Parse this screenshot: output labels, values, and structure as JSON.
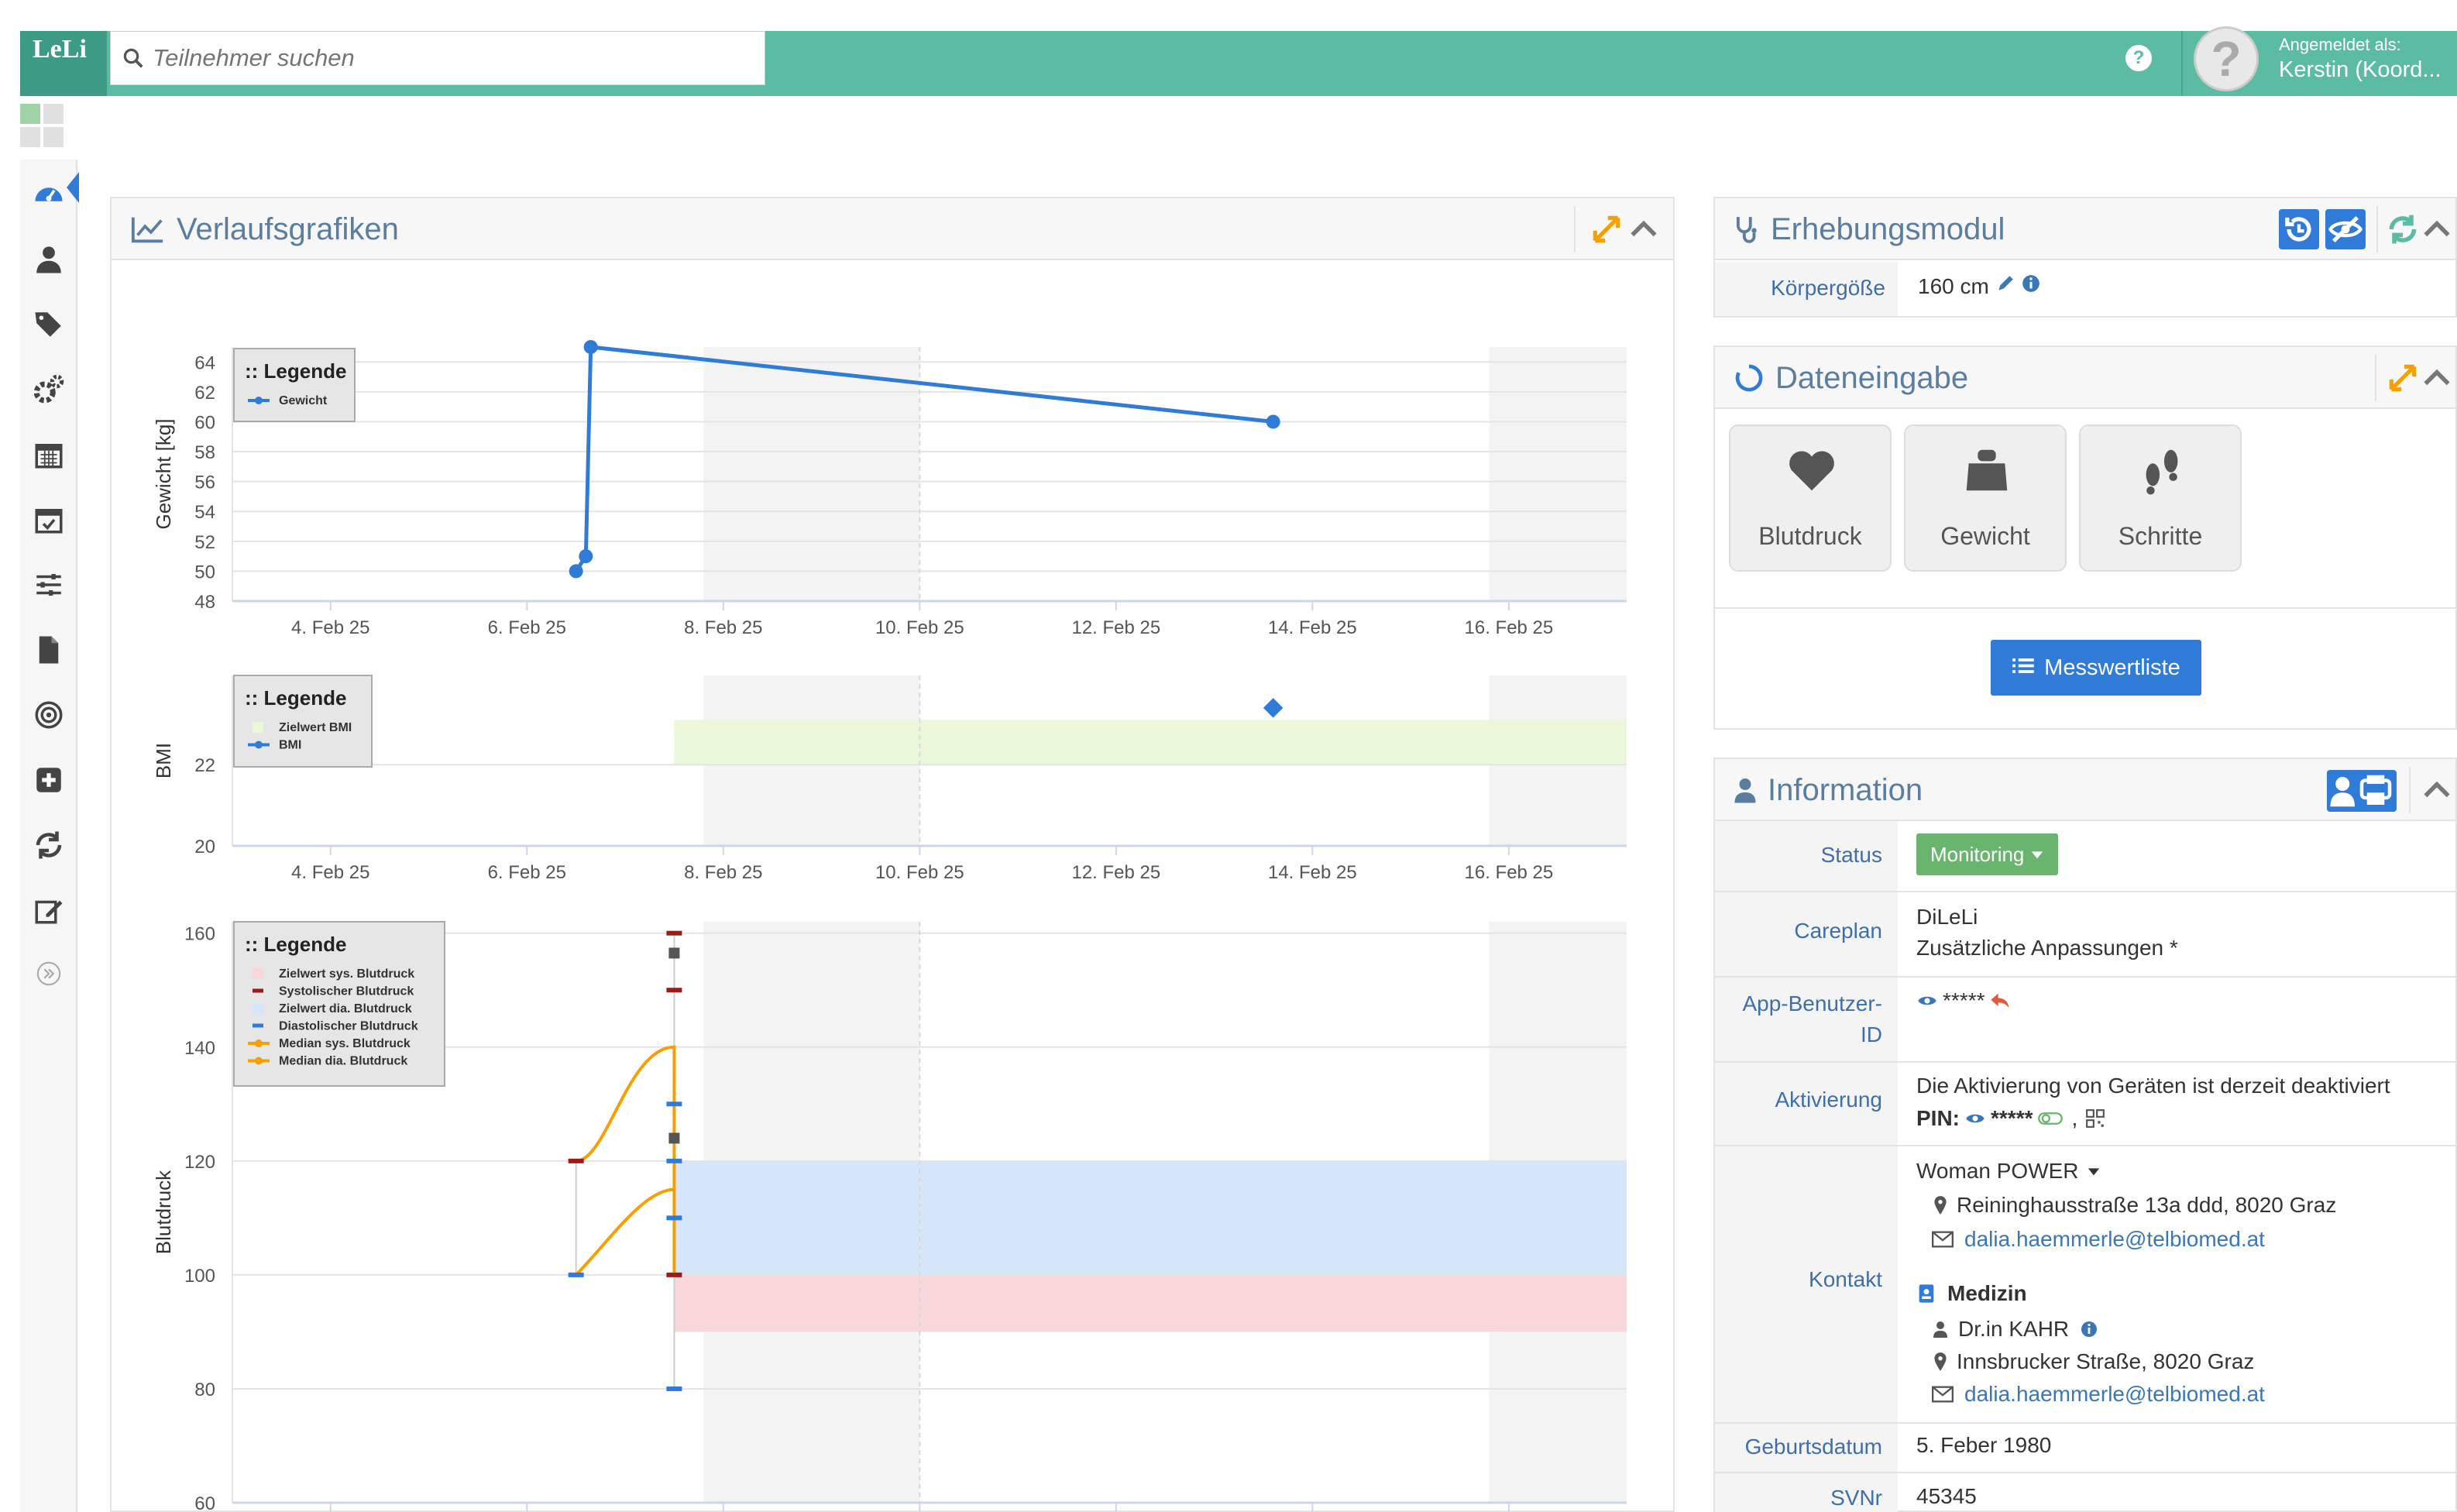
{
  "header": {
    "logo_text": "LeLi",
    "search_placeholder": "Teilnehmer suchen",
    "help": "?",
    "user_label": "Angemeldet als:",
    "user_name": "Kerstin (Koord..."
  },
  "colors": {
    "topbar": "#5bbca3",
    "accent": "#2f7bd7",
    "orange": "#f5a000",
    "target_sys": "#f8d7da",
    "target_dia": "#d6e6fa",
    "target_bmi": "#eaf7d8"
  },
  "sidebar": {
    "icons": [
      "dashboard-icon",
      "user-icon",
      "tags-icon",
      "cogs-icon",
      "calendar-icon",
      "calendar-check-icon",
      "sliders-icon",
      "file-icon",
      "target-icon",
      "plus-square-icon",
      "refresh-icon",
      "edit-icon",
      "chevron-double-right-icon"
    ]
  },
  "verlauf": {
    "title": "Verlaufsgrafiken",
    "legend_title": ":: Legende"
  },
  "chart_data": [
    {
      "type": "line",
      "ylabel": "Gewicht [kg]",
      "ylim": [
        48,
        65
      ],
      "yticks": [
        48,
        50,
        52,
        54,
        56,
        58,
        60,
        62,
        64
      ],
      "xticks": [
        "4. Feb 25",
        "6. Feb 25",
        "8. Feb 25",
        "10. Feb 25",
        "12. Feb 25",
        "14. Feb 25",
        "16. Feb 25"
      ],
      "series": [
        {
          "name": "Gewicht",
          "x": [
            6.5,
            6.6,
            6.65,
            13.6
          ],
          "y": [
            50,
            51,
            65,
            60
          ]
        }
      ]
    },
    {
      "type": "scatter",
      "ylabel": "BMI",
      "ylim": [
        20,
        24.2
      ],
      "yticks": [
        20,
        22
      ],
      "xticks": [
        "4. Feb 25",
        "6. Feb 25",
        "8. Feb 25",
        "10. Feb 25",
        "12. Feb 25",
        "14. Feb 25",
        "16. Feb 25"
      ],
      "target": {
        "name": "Zielwert BMI",
        "from": 22,
        "to": 23.1,
        "x_from": 7.5
      },
      "series": [
        {
          "name": "BMI",
          "x": [
            13.6
          ],
          "y": [
            23.4
          ]
        }
      ]
    },
    {
      "type": "line",
      "ylabel": "Blutdruck",
      "ylim": [
        60,
        162
      ],
      "yticks": [
        60,
        80,
        100,
        120,
        140,
        160
      ],
      "legend": [
        "Zielwert sys. Blutdruck",
        "Systolischer Blutdruck",
        "Zielwert dia. Blutdruck",
        "Diastolischer Blutdruck",
        "Median sys. Blutdruck",
        "Median dia. Blutdruck"
      ],
      "target_sys": {
        "from": 90,
        "to": 100,
        "x_from": 7.5
      },
      "target_dia": {
        "from": 100,
        "to": 120,
        "x_from": 7.5
      },
      "systolic": {
        "x": [
          6.5,
          7.5,
          7.5,
          7.5
        ],
        "y": [
          120,
          160,
          150,
          100
        ]
      },
      "diastolic": {
        "x": [
          6.5,
          7.5,
          7.5,
          7.5,
          7.5
        ],
        "y": [
          100,
          130,
          120,
          110,
          80
        ]
      },
      "median_sys": {
        "x": [
          6.5,
          7.5
        ],
        "y": [
          120,
          140
        ]
      },
      "median_dia": {
        "x": [
          6.5,
          7.5
        ],
        "y": [
          100,
          115
        ]
      }
    }
  ],
  "erhebung": {
    "title": "Erhebungsmodul",
    "koerper_label": "Körpergöße",
    "koerper_value": "160 cm"
  },
  "dateneingabe": {
    "title": "Dateneingabe",
    "buttons": [
      "Blutdruck",
      "Gewicht",
      "Schritte"
    ],
    "list_button": "Messwertliste"
  },
  "info": {
    "title": "Information",
    "status_label": "Status",
    "status_value": "Monitoring",
    "careplan_label": "Careplan",
    "careplan_1": "DiLeLi",
    "careplan_2": "Zusätzliche Anpassungen *",
    "app_label_1": "App-Benutzer-",
    "app_label_2": "ID",
    "app_value": "*****",
    "akt_label": "Aktivierung",
    "akt_text": "Die Aktivierung von Geräten ist derzeit deaktiviert",
    "pin_label": "PIN:",
    "pin_value": "*****",
    "kontakt_label": "Kontakt",
    "kontakt_name": "Woman POWER",
    "kontakt_addr": "Reininghausstraße 13a ddd, 8020 Graz",
    "kontakt_mail": "dalia.haemmerle@telbiomed.at",
    "med_title": "Medizin",
    "med_name": "Dr.in KAHR",
    "med_addr": "Innsbrucker Straße, 8020 Graz",
    "med_mail": "dalia.haemmerle@telbiomed.at",
    "geb_label": "Geburtsdatum",
    "geb_value": "5. Feber 1980",
    "svnr_label": "SVNr",
    "svnr_value": "45345"
  }
}
